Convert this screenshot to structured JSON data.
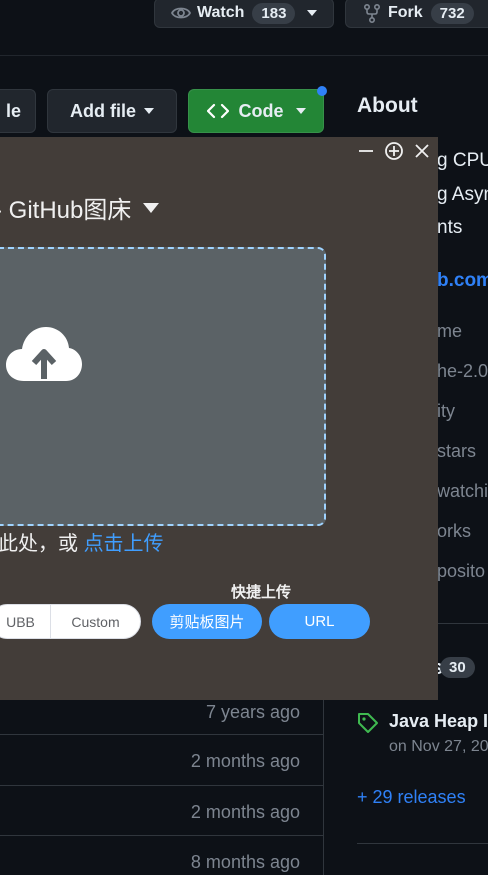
{
  "repo_actions": {
    "watch_label": "Watch",
    "watch_count": "183",
    "fork_label": "Fork",
    "fork_count": "732"
  },
  "toolbar": {
    "partial_button_label": "le",
    "add_file_label": "Add file",
    "code_label": "Code"
  },
  "sidebar": {
    "about_title": "About",
    "desc_line1": "g CPU",
    "desc_line2": "g Asyn",
    "desc_line3": "nts",
    "link_text": "b.com",
    "item_readme": "me",
    "item_license": "he-2.0",
    "item_activity": "ity",
    "item_stars": "stars",
    "item_watching": "watchin",
    "item_forks": "orks",
    "item_report": "posito",
    "releases_partial": "s",
    "releases_count": "30",
    "latest_release_title": "Java Heap I",
    "latest_release_date": "on Nov 27, 20",
    "more_releases": "+ 29 releases"
  },
  "file_list": {
    "ages": [
      "7 years ago",
      "2 months ago",
      "2 months ago",
      "8 months ago"
    ]
  },
  "uploader": {
    "title": "- GitHub图床",
    "drop_prefix": "到此处，或 ",
    "drop_link": "点击上传",
    "quick_upload_label": "快捷上传",
    "format_options": [
      "UBB",
      "Custom"
    ],
    "clipboard_button": "剪贴板图片",
    "url_button": "URL"
  },
  "colors": {
    "page_bg": "#0d1117",
    "accent_blue": "#409eff",
    "github_green": "#238636",
    "overlay_bg": "#433d39"
  }
}
